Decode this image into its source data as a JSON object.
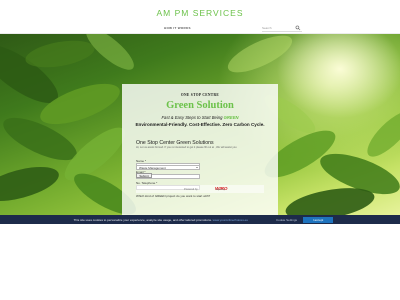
{
  "header": {
    "title": "AM PM SERVICES"
  },
  "nav": {
    "links": [
      "HOW IT WORKS"
    ],
    "search_label": "Search",
    "search_icon": "search-icon"
  },
  "form_card": {
    "kicker": "ONE STOP CENTRE",
    "title": "Green Solution",
    "tagline_pre": "Fast & Easy Steps to Start Being ",
    "tagline_highlight": "GREEN",
    "tagline2": "Environmental-Friendly. Cost-Effective. Zero Carbon Cycle.",
    "form_title": "One Stop Center Green Solutions",
    "intro": "Hi, Let us assist  formed. If you re interested to get  it  please fill out   at , We will assist you ",
    "fields": [
      {
        "label": "Name *",
        "value": ""
      },
      {
        "label": "Email *",
        "value": ""
      },
      {
        "label": "No. Telephone *",
        "value": ""
      }
    ],
    "question_label": "Which kind of GREEN project do you want to start with?",
    "select_value": "Waste Management",
    "submit_label": "Submit",
    "powered_by": "Powered by",
    "brand": "WIRO",
    "brand_sub": "Engineering"
  },
  "cookie": {
    "text": "This site uses cookies to personalize your experience, analyze site usage, and offer tailored promotions.",
    "link": "www.youronlinechoices.eu",
    "settings_label": "Cookie Settings",
    "accept_label": "I accept"
  },
  "colors": {
    "brand_green": "#6cc24a",
    "cookie_bg": "#1d2b4a",
    "accept_blue": "#1e73be"
  }
}
